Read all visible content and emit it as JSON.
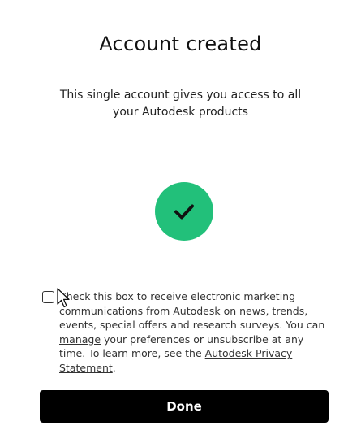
{
  "header": {
    "title": "Account created",
    "subtitle": "This single account gives you access to all your Autodesk products"
  },
  "status": {
    "icon": "check-icon",
    "color": "#22c07a"
  },
  "consent": {
    "checked": false,
    "text_before_manage": "Check this box to receive electronic marketing communications from Autodesk on news, trends, events, special offers and research surveys. You can ",
    "manage_link": "manage",
    "text_after_manage": " your preferences or unsubscribe at any time. To learn more, see the ",
    "privacy_link": "Autodesk Privacy Statement",
    "text_end": "."
  },
  "actions": {
    "done_label": "Done",
    "done_color": "#000000"
  }
}
